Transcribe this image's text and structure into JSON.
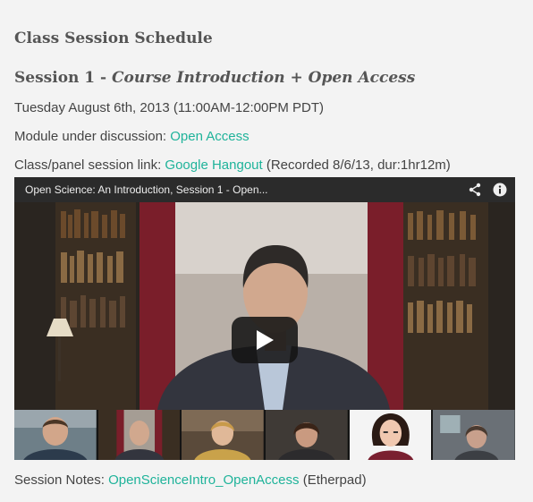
{
  "schedule_heading": "Class Session Schedule",
  "session": {
    "label": "Session 1 - ",
    "title": "Course Introduction + Open Access",
    "date": "Tuesday August 6th, 2013 (11:00AM-12:00PM PDT)",
    "module_label": "Module under discussion: ",
    "module_link": "Open Access",
    "class_link_label": "Class/panel session link: ",
    "class_link": "Google Hangout",
    "recorded": " (Recorded 8/6/13, dur:1hr12m)",
    "notes_label": "Session Notes: ",
    "notes_link": "OpenScienceIntro_OpenAccess",
    "notes_suffix": " (Etherpad)"
  },
  "video": {
    "title": "Open Science: An Introduction, Session 1 - Open...",
    "icons": [
      "share-icon",
      "info-icon",
      "play-icon"
    ]
  },
  "colors": {
    "link": "#1fb39a",
    "background": "#f3f3f3",
    "player_bar": "#2b2b2b"
  }
}
